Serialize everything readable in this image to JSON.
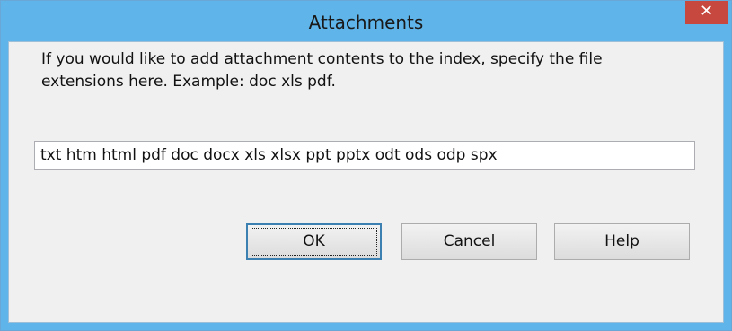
{
  "window": {
    "title": "Attachments",
    "close_glyph": "✕"
  },
  "dialog": {
    "description": "If you would like to add attachment contents to the index, specify the file extensions here. Example: doc xls pdf.",
    "extensions_value": "txt htm html pdf doc docx xls xlsx ppt pptx odt ods odp spx"
  },
  "buttons": {
    "ok_label": "OK",
    "cancel_label": "Cancel",
    "help_label": "Help"
  },
  "colors": {
    "titlebar": "#5fb5e9",
    "close_button": "#c7483e",
    "client_background": "#f0f0f0"
  }
}
